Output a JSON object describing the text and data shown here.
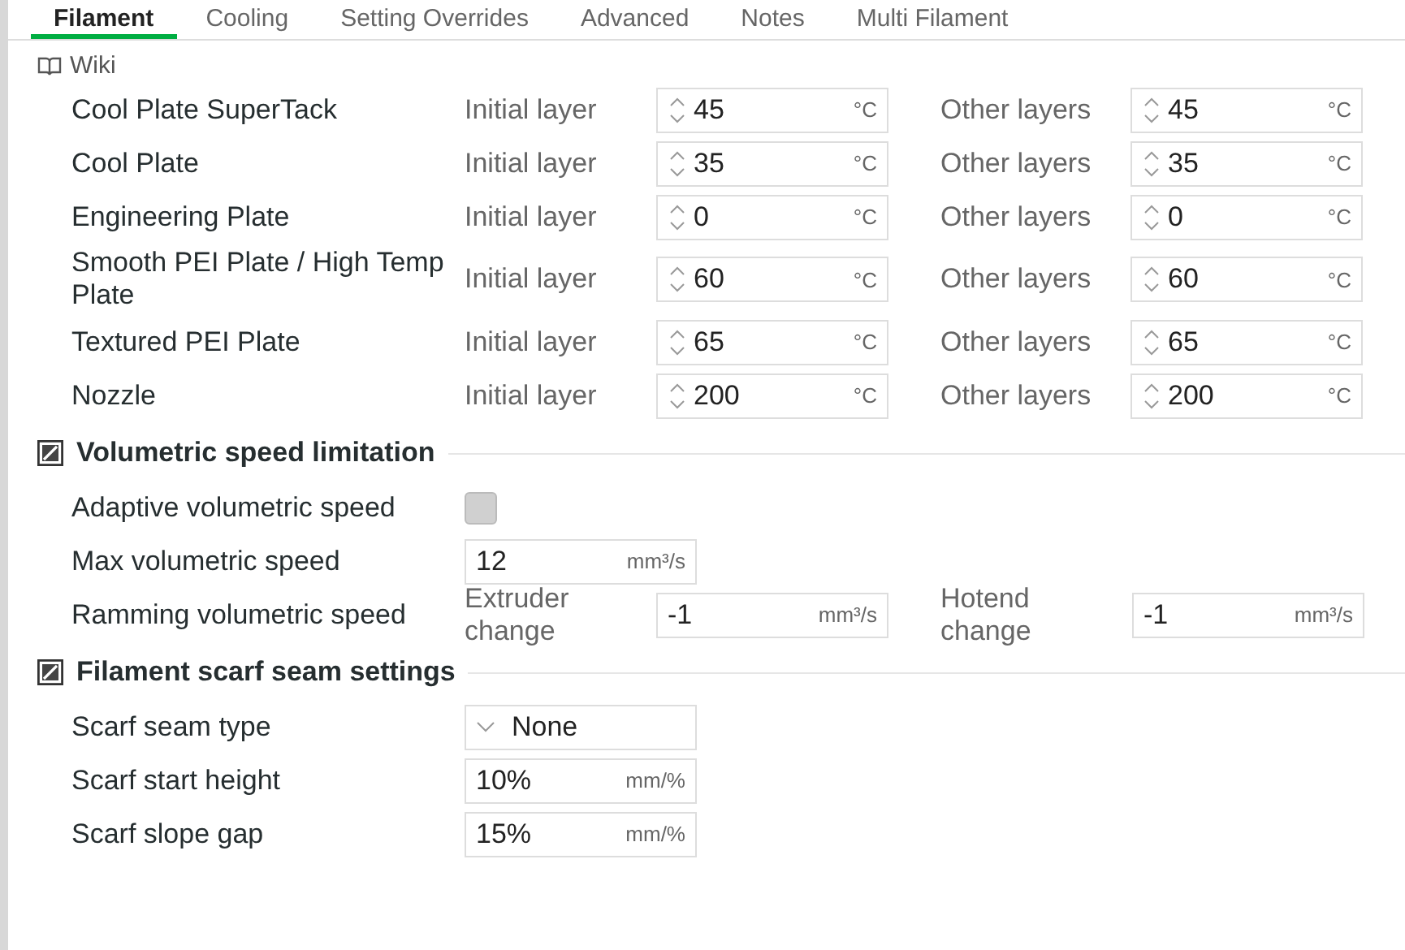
{
  "tabs": [
    {
      "label": "Filament",
      "selected": true
    },
    {
      "label": "Cooling",
      "selected": false
    },
    {
      "label": "Setting Overrides",
      "selected": false
    },
    {
      "label": "Advanced",
      "selected": false
    },
    {
      "label": "Notes",
      "selected": false
    },
    {
      "label": "Multi Filament",
      "selected": false
    }
  ],
  "wiki": {
    "label": "Wiki"
  },
  "temperature_rows": [
    {
      "name": "Cool Plate SuperTack",
      "initial_label": "Initial layer",
      "initial_value": "45",
      "initial_unit": "°C",
      "other_label": "Other layers",
      "other_value": "45",
      "other_unit": "°C"
    },
    {
      "name": "Cool Plate",
      "initial_label": "Initial layer",
      "initial_value": "35",
      "initial_unit": "°C",
      "other_label": "Other layers",
      "other_value": "35",
      "other_unit": "°C"
    },
    {
      "name": "Engineering Plate",
      "initial_label": "Initial layer",
      "initial_value": "0",
      "initial_unit": "°C",
      "other_label": "Other layers",
      "other_value": "0",
      "other_unit": "°C"
    },
    {
      "name": "Smooth PEI Plate / High Temp Plate",
      "initial_label": "Initial layer",
      "initial_value": "60",
      "initial_unit": "°C",
      "other_label": "Other layers",
      "other_value": "60",
      "other_unit": "°C"
    },
    {
      "name": "Textured PEI Plate",
      "initial_label": "Initial layer",
      "initial_value": "65",
      "initial_unit": "°C",
      "other_label": "Other layers",
      "other_value": "65",
      "other_unit": "°C"
    },
    {
      "name": "Nozzle",
      "initial_label": "Initial layer",
      "initial_value": "200",
      "initial_unit": "°C",
      "other_label": "Other layers",
      "other_value": "200",
      "other_unit": "°C"
    }
  ],
  "sections": [
    {
      "title": "Volumetric speed limitation",
      "rows": [
        {
          "kind": "checkbox",
          "label": "Adaptive volumetric speed",
          "checked": false
        },
        {
          "kind": "input",
          "label": "Max volumetric speed",
          "value": "12",
          "unit": "mm³/s"
        },
        {
          "kind": "dual",
          "label": "Ramming volumetric speed",
          "first_label": "Extruder change",
          "first_value": "-1",
          "first_unit": "mm³/s",
          "second_label": "Hotend change",
          "second_value": "-1",
          "second_unit": "mm³/s"
        }
      ]
    },
    {
      "title": "Filament scarf seam settings",
      "rows": [
        {
          "kind": "dropdown",
          "label": "Scarf seam type",
          "value": "None"
        },
        {
          "kind": "input",
          "label": "Scarf start height",
          "value": "10%",
          "unit": "mm/%"
        },
        {
          "kind": "input",
          "label": "Scarf slope gap",
          "value": "15%",
          "unit": "mm/%"
        }
      ]
    }
  ]
}
